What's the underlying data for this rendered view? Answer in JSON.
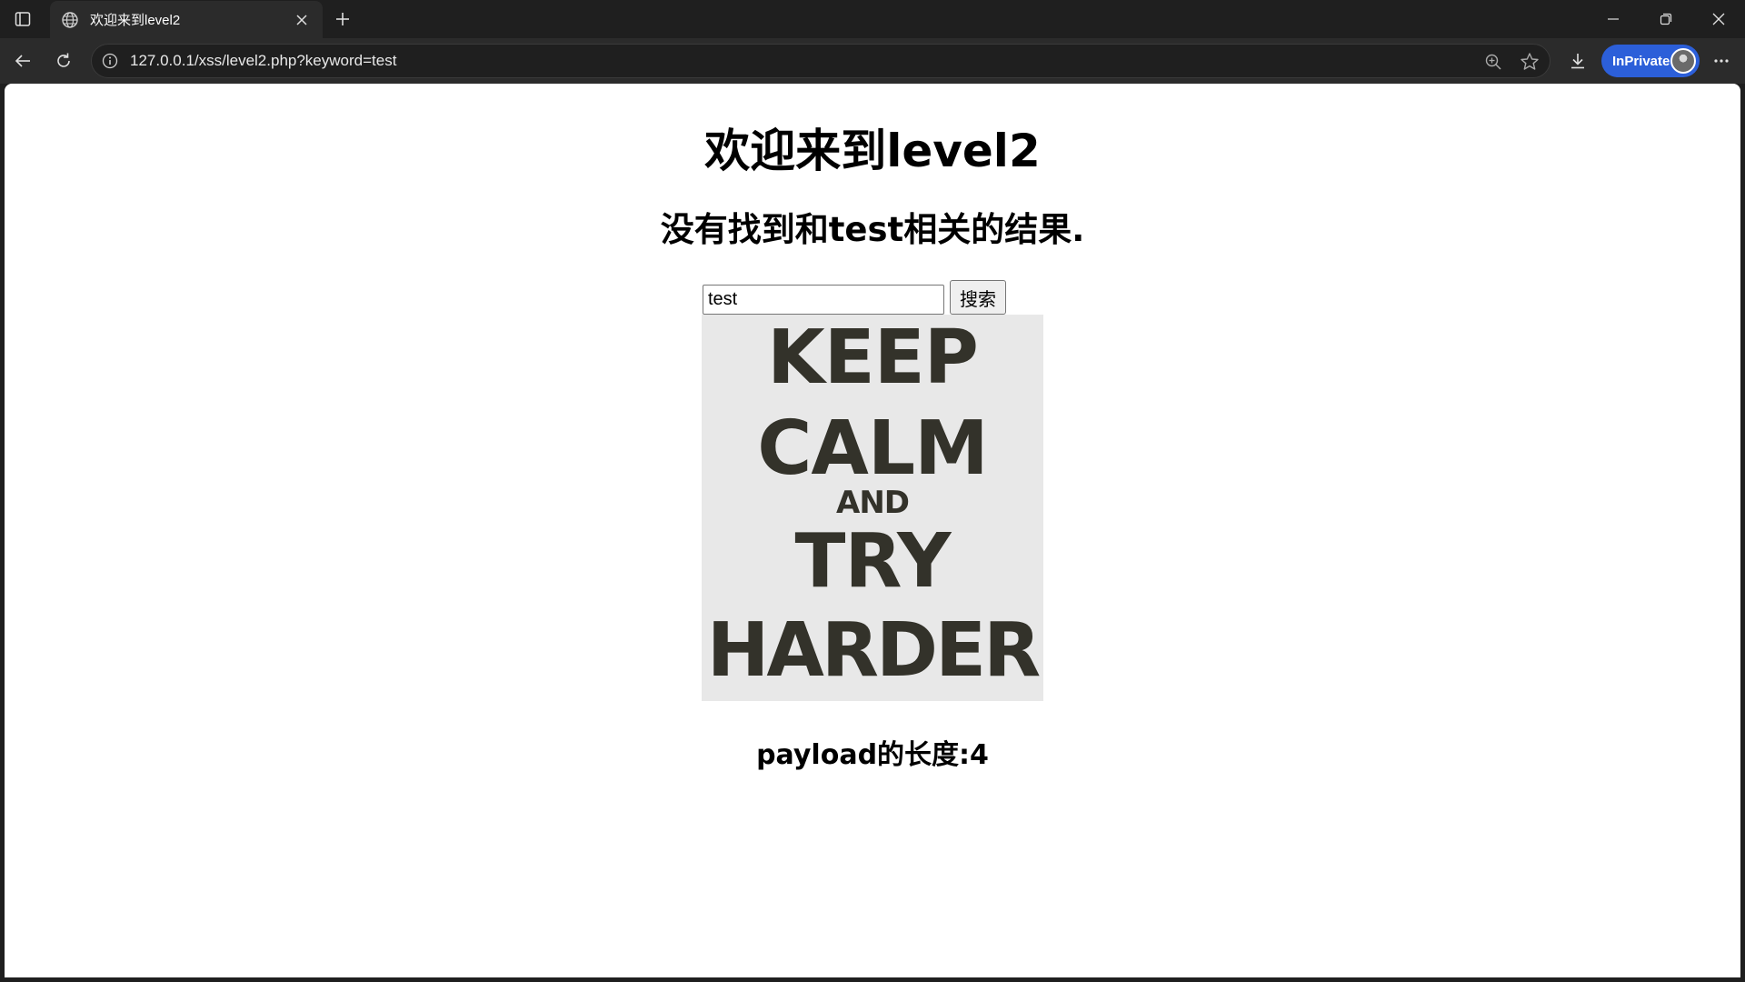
{
  "browser": {
    "tab": {
      "title": "欢迎来到level2"
    },
    "address_bar": {
      "url": "127.0.0.1/xss/level2.php?keyword=test"
    },
    "profile": {
      "label": "InPrivate"
    }
  },
  "page": {
    "heading": "欢迎来到level2",
    "result_message": "没有找到和test相关的结果.",
    "search": {
      "value": "test",
      "button_label": "搜索"
    },
    "poster": {
      "line1": "KEEP",
      "line2": "CALM",
      "line3": "AND",
      "line4": "TRY",
      "line5": "HARDER"
    },
    "payload_length": "payload的长度:4"
  },
  "colors": {
    "inprivate_badge": "#2c5fd9",
    "poster_bg": "#e8e8e8",
    "poster_text": "#33322a"
  }
}
